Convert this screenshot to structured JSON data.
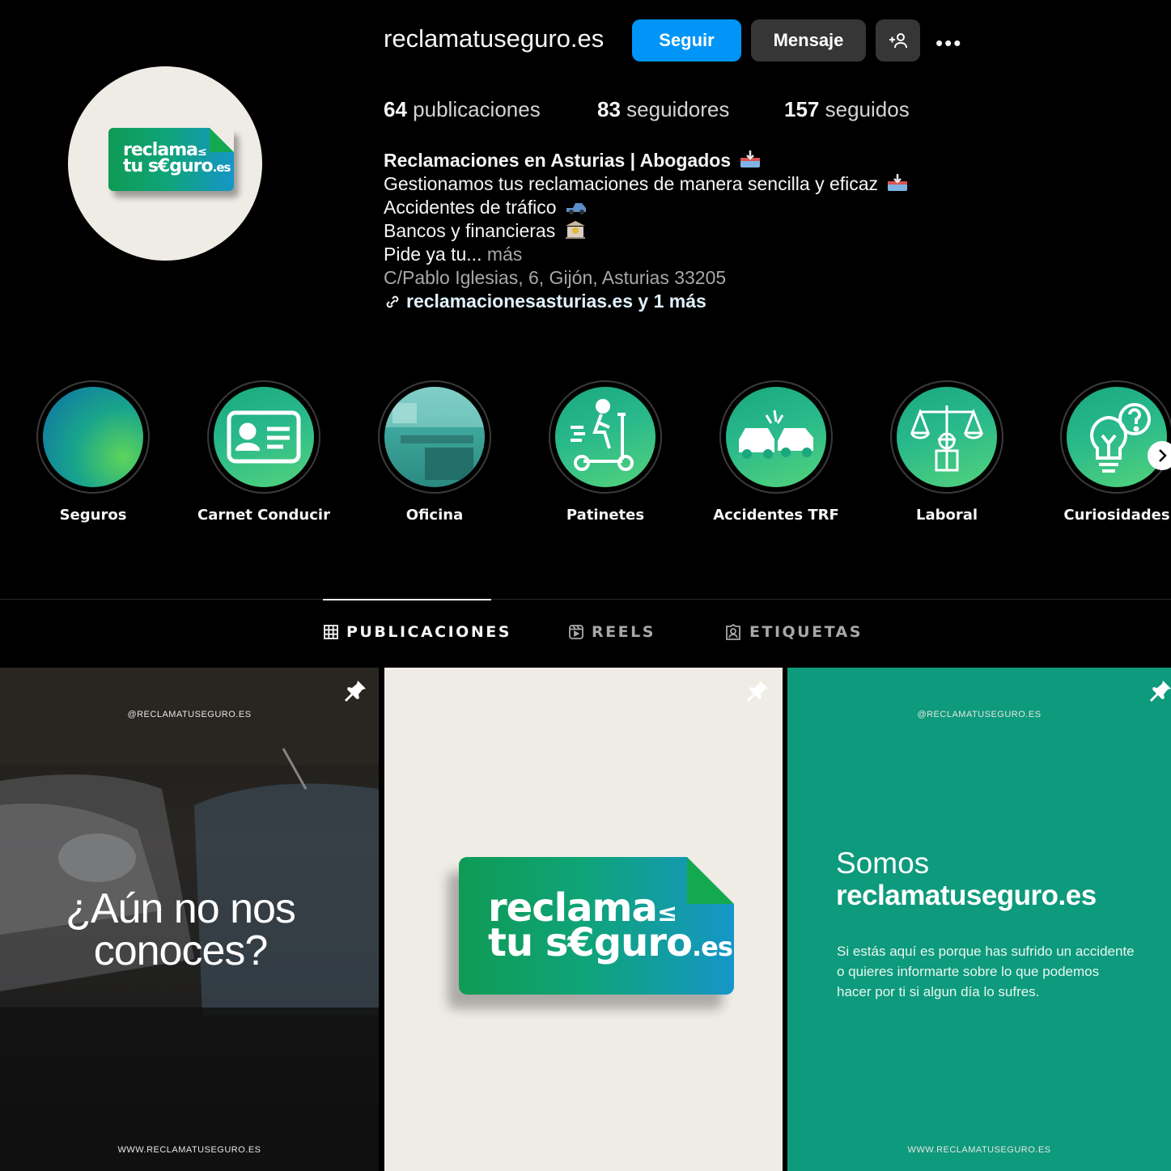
{
  "profile": {
    "username": "reclamatuseguro.es",
    "buttons": {
      "follow": "Seguir",
      "message": "Mensaje"
    },
    "stats": {
      "posts_count": "64",
      "posts_label": "publicaciones",
      "followers_count": "83",
      "followers_label": "seguidores",
      "following_count": "157",
      "following_label": "seguidos"
    },
    "bio": {
      "name": "Reclamaciones en Asturias | Abogados",
      "line1": "Gestionamos tus reclamaciones de manera sencilla y eficaz",
      "line2": "Accidentes de tráfico",
      "line3": "Bancos y financieras",
      "line4": "Pide ya tu...",
      "more": "más",
      "address": "C/Pablo Iglesias, 6, Gijón, Asturias 33205",
      "link": "reclamacionesasturias.es y 1 más"
    },
    "logo": {
      "line1": "reclama",
      "line2a": "tu s€guro",
      "line2b": ".es"
    }
  },
  "highlights": [
    {
      "label": "Seguros",
      "icon": "gradient-cover"
    },
    {
      "label": "Carnet Conducir",
      "icon": "id-card-icon"
    },
    {
      "label": "Oficina",
      "icon": "office-photo"
    },
    {
      "label": "Patinetes",
      "icon": "scooter-icon"
    },
    {
      "label": "Accidentes TRF",
      "icon": "car-crash-icon"
    },
    {
      "label": "Laboral",
      "icon": "scales-worker-icon"
    },
    {
      "label": "Curiosidades",
      "icon": "lightbulb-question-icon"
    }
  ],
  "tabs": [
    {
      "label": "PUBLICACIONES",
      "icon": "grid-icon",
      "active": true
    },
    {
      "label": "REELS",
      "icon": "reels-icon",
      "active": false
    },
    {
      "label": "ETIQUETAS",
      "icon": "tagged-icon",
      "active": false
    }
  ],
  "posts": {
    "post1": {
      "handle": "@RECLAMATUSEGURO.ES",
      "headline_line1": "¿Aún no nos",
      "headline_line2": "conoces?",
      "footer": "WWW.RECLAMATUSEGURO.ES"
    },
    "post2": {
      "logo_line1": "reclama",
      "logo_line2a": "tu s€guro",
      "logo_line2b": ".es"
    },
    "post3": {
      "handle": "@RECLAMATUSEGURO.ES",
      "title": "Somos",
      "brand": "reclamatuseguro.es",
      "paragraph": "Si estás aquí es porque has sufrido un accidente o quieres informarte sobre lo que podemos hacer por ti si algun día lo sufres.",
      "footer": "WWW.RECLAMATUSEGURO.ES"
    }
  },
  "colors": {
    "accent": "#0095f6",
    "brand_green": "#0e9a7c",
    "background": "#000000"
  }
}
